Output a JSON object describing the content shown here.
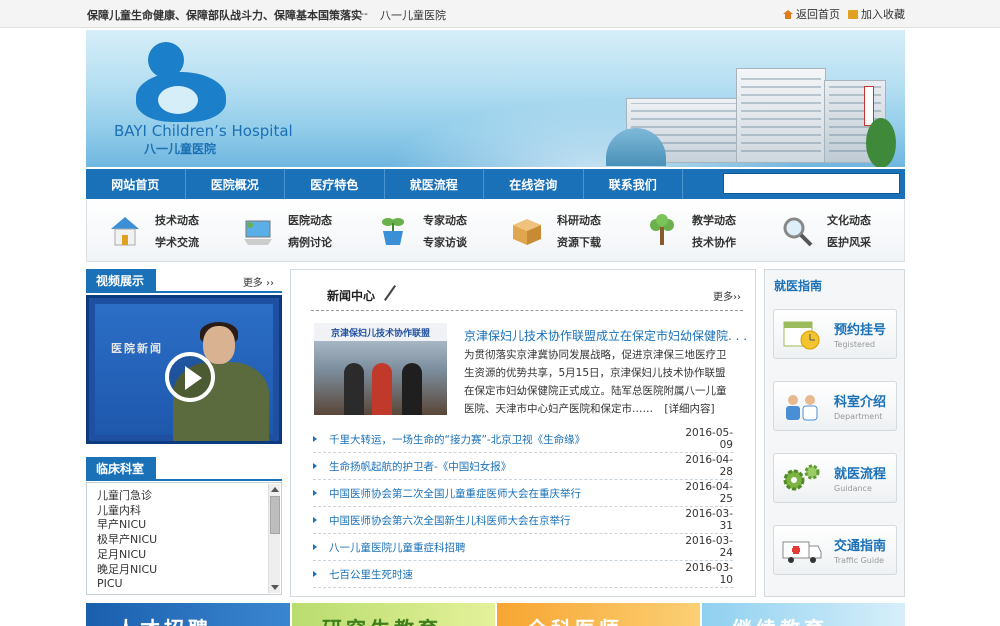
{
  "topbar": {
    "slogan": "保障儿童生命健康、保障部队战斗力、保障基本国策落实",
    "separator": "--",
    "hospital": "八一儿童医院",
    "home_label": "返回首页",
    "favorite_label": "加入收藏"
  },
  "banner": {
    "brand_en": "BAYI Children’s Hospital",
    "brand_cn": "八一儿童医院"
  },
  "nav": {
    "items": [
      "网站首页",
      "医院概况",
      "医疗特色",
      "就医流程",
      "在线咨询",
      "联系我们"
    ],
    "search_value": ""
  },
  "icon_row": [
    {
      "icon": "house-icon",
      "line1": "技术动态",
      "line2": "学术交流"
    },
    {
      "icon": "computer-icon",
      "line1": "医院动态",
      "line2": "病例讨论"
    },
    {
      "icon": "plant-pot-icon",
      "line1": "专家动态",
      "line2": "专家访谈"
    },
    {
      "icon": "box-icon",
      "line1": "科研动态",
      "line2": "资源下载"
    },
    {
      "icon": "tree-icon",
      "line1": "教学动态",
      "line2": "技术协作"
    },
    {
      "icon": "magnifier-icon",
      "line1": "文化动态",
      "line2": "医护风采"
    }
  ],
  "video": {
    "title": "视频展示",
    "more": "更多",
    "overlay_text": "医院新闻"
  },
  "departments": {
    "title": "临床科室",
    "items": [
      "儿童门急诊",
      "儿童内科",
      "早产NICU",
      "极早产NICU",
      "足月NICU",
      "晚足月NICU",
      "PICU"
    ]
  },
  "news": {
    "title": "新闻中心",
    "more": "更多",
    "feature": {
      "image_caption": "京津保妇儿技术协作联盟",
      "title": "京津保妇儿技术协作联盟成立在保定市妇幼保健院. . .",
      "body": "为贯彻落实京津冀协同发展战略，促进京津保三地医疗卫生资源的优势共享，5月15日，京津保妇儿技术协作联盟在保定市妇幼保健院正式成立。陆军总医院附属八一儿童医院、天津市中心妇产医院和保定市……",
      "detail_link": "[详细内容]"
    },
    "items": [
      {
        "title": "千里大转运，一场生命的“接力赛”-北京卫视《生命缘》",
        "date": "2016-05-09"
      },
      {
        "title": "生命扬帆起航的护卫者-《中国妇女报》",
        "date": "2016-04-28"
      },
      {
        "title": "中国医师协会第二次全国儿童重症医师大会在重庆举行",
        "date": "2016-04-25"
      },
      {
        "title": "中国医师协会第六次全国新生儿科医师大会在京举行",
        "date": "2016-03-31"
      },
      {
        "title": "八一儿童医院儿童重症科招聘",
        "date": "2016-03-24"
      },
      {
        "title": "七百公里生死时速",
        "date": "2016-03-10"
      }
    ]
  },
  "guide": {
    "title": "就医指南",
    "cards": [
      {
        "icon": "calendar-clock-icon",
        "cn": "预约挂号",
        "en": "Tegistered"
      },
      {
        "icon": "doctors-icon",
        "cn": "科室介绍",
        "en": "Department"
      },
      {
        "icon": "gears-icon",
        "cn": "就医流程",
        "en": "Guidance"
      },
      {
        "icon": "ambulance-icon",
        "cn": "交通指南",
        "en": "Traffic Guide"
      }
    ]
  },
  "bottom_banners": [
    {
      "text": "人才招聘",
      "color": "#1a5fae"
    },
    {
      "text": "研究生教育",
      "color": "#7ab648"
    },
    {
      "text": "全科医师",
      "color": "#f39a24"
    },
    {
      "text": "继续教育",
      "color": "#4da9df"
    }
  ]
}
